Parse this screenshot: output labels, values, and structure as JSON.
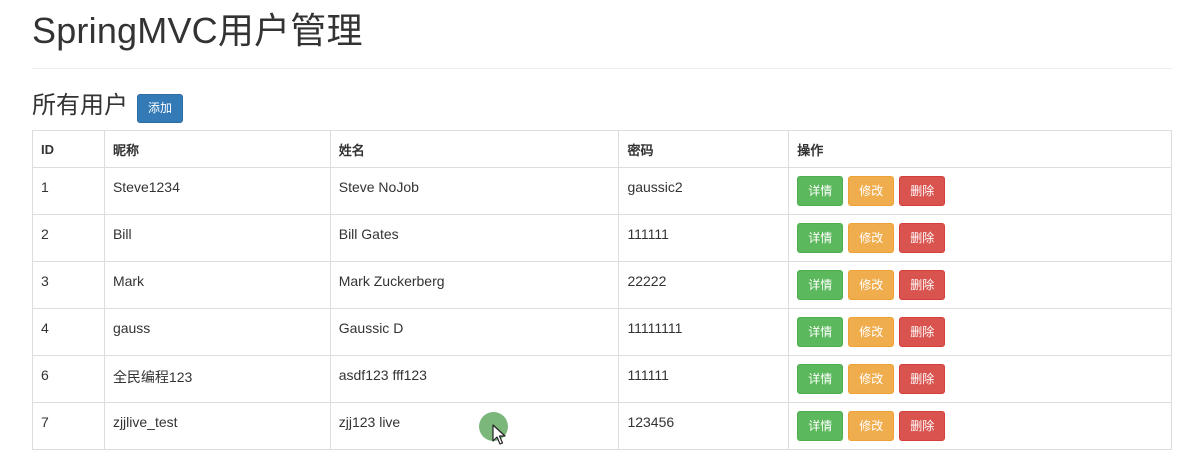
{
  "page": {
    "title": "SpringMVC用户管理"
  },
  "section": {
    "title": "所有用户",
    "add_label": "添加"
  },
  "table": {
    "headers": [
      "ID",
      "昵称",
      "姓名",
      "密码",
      "操作"
    ],
    "rows": [
      {
        "id": "1",
        "nickname": "Steve1234",
        "name": "Steve NoJob",
        "password": "gaussic2"
      },
      {
        "id": "2",
        "nickname": "Bill",
        "name": "Bill Gates",
        "password": "111111"
      },
      {
        "id": "3",
        "nickname": "Mark",
        "name": "Mark Zuckerberg",
        "password": "22222"
      },
      {
        "id": "4",
        "nickname": "gauss",
        "name": "Gaussic D",
        "password": "11111111"
      },
      {
        "id": "6",
        "nickname": "全民编程123",
        "name": "asdf123 fff123",
        "password": "111111"
      },
      {
        "id": "7",
        "nickname": "zjjlive_test",
        "name": "zjj123 live",
        "password": "123456"
      }
    ],
    "actions": {
      "detail": "详情",
      "edit": "修改",
      "delete": "删除"
    }
  },
  "colors": {
    "primary": "#337ab7",
    "success": "#5cb85c",
    "warning": "#f0ad4e",
    "danger": "#d9534f",
    "cursor_highlight": "#64aa64"
  },
  "icons": {
    "cursor": "mouse-pointer-icon"
  }
}
